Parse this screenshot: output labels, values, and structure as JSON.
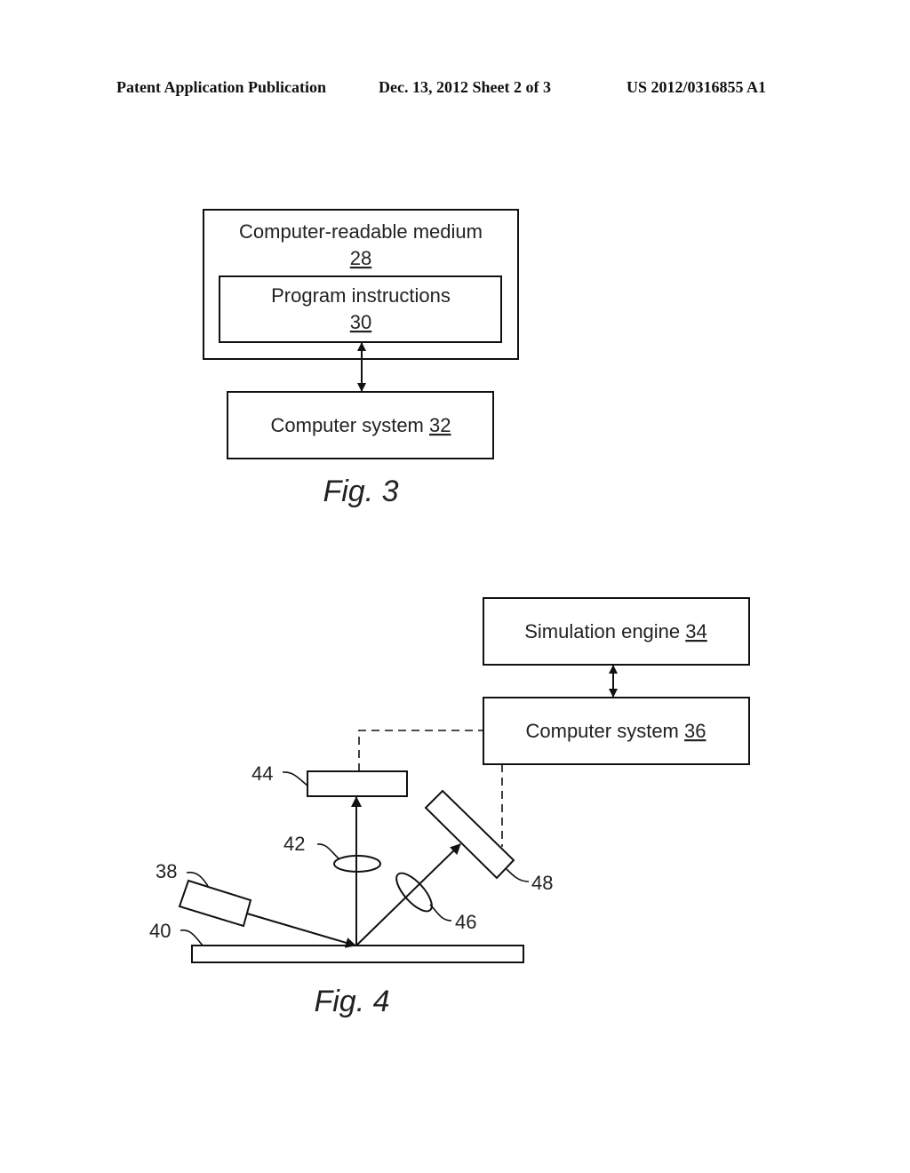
{
  "header": {
    "left": "Patent Application Publication",
    "middle": "Dec. 13, 2012   Sheet 2 of 3",
    "right": "US 2012/0316855 A1"
  },
  "fig3": {
    "caption": "Fig. 3",
    "medium": {
      "label": "Computer-readable medium",
      "ref": "28"
    },
    "instructions": {
      "label": "Program instructions",
      "ref": "30"
    },
    "computer": {
      "label": "Computer system ",
      "ref": "32"
    }
  },
  "fig4": {
    "caption": "Fig. 4",
    "simulation": {
      "label": "Simulation engine ",
      "ref": "34"
    },
    "computer": {
      "label": "Computer system ",
      "ref": "36"
    },
    "refs": {
      "light_source": "38",
      "specimen": "40",
      "lens_normal": "42",
      "detector_normal": "44",
      "lens_oblique": "46",
      "detector_oblique": "48"
    }
  }
}
